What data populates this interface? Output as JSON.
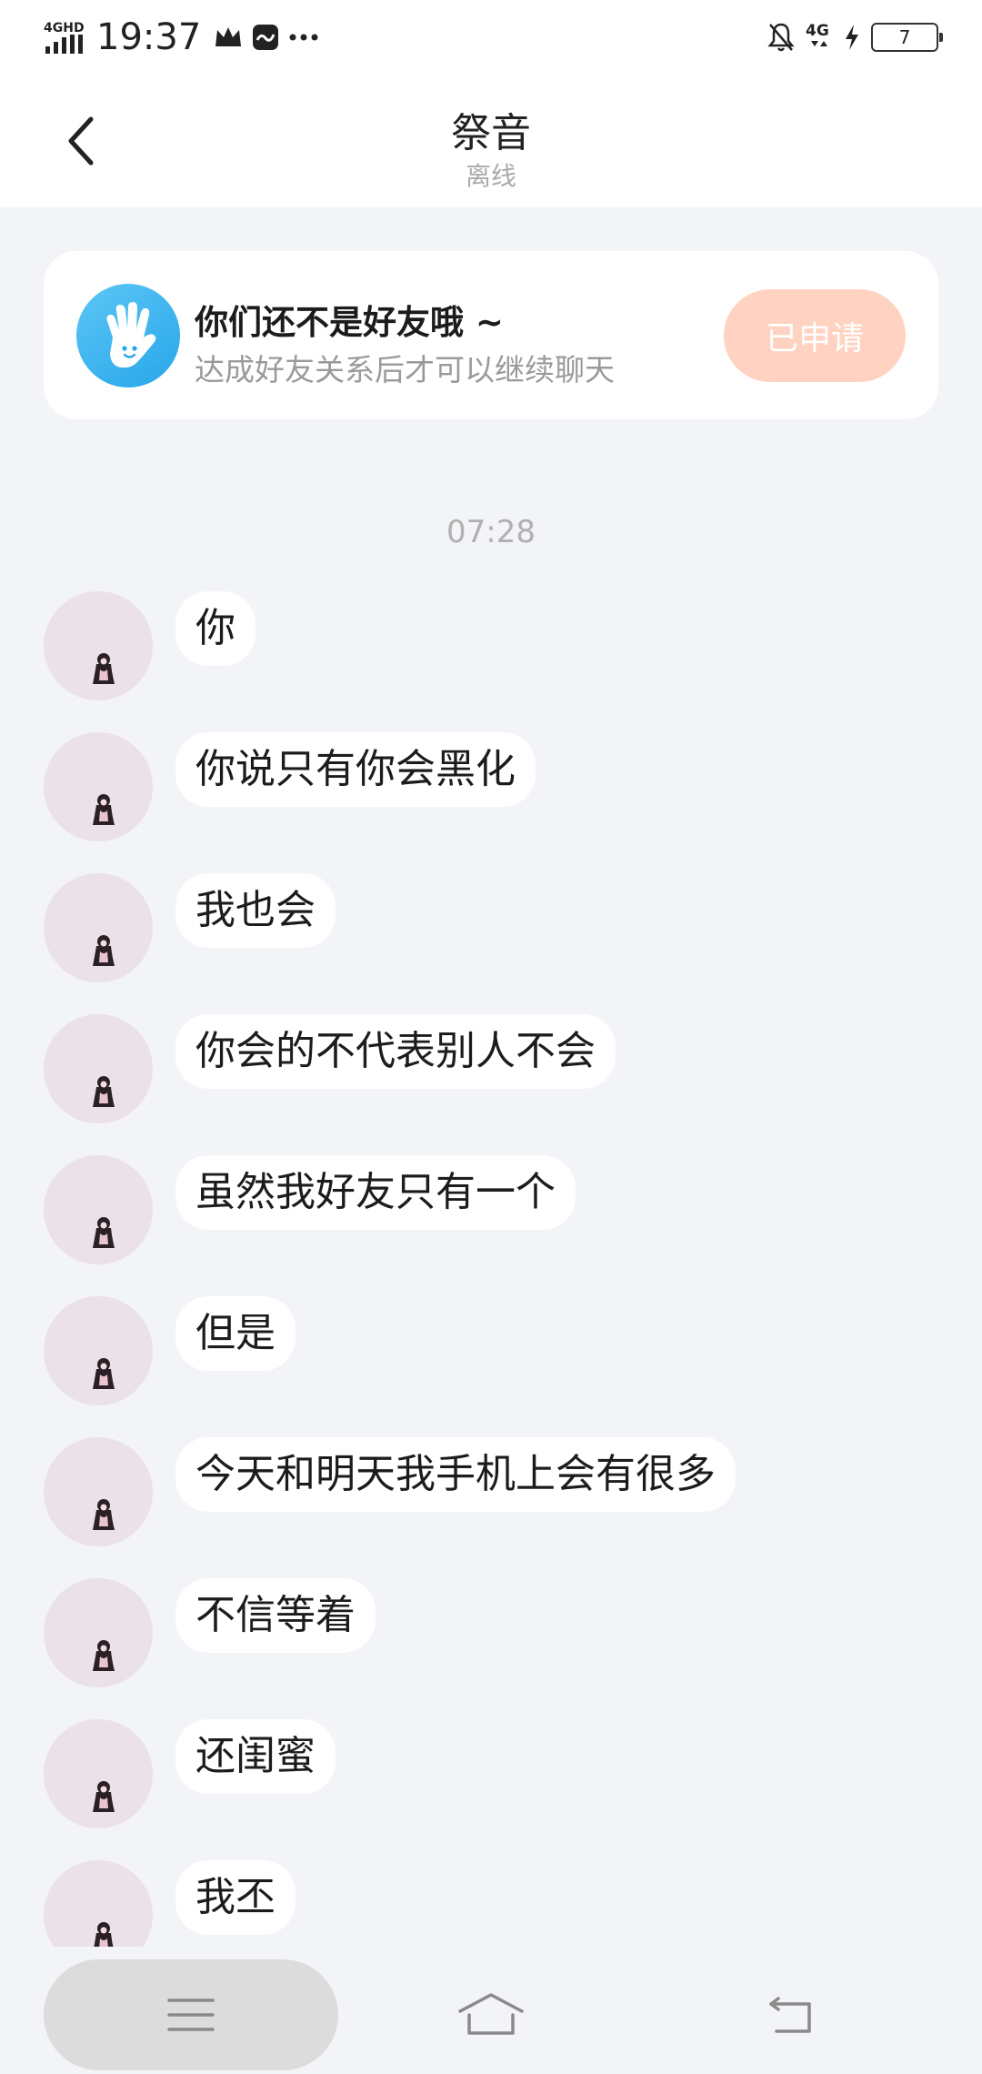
{
  "status_bar": {
    "network": "4GHD",
    "time": "19:37",
    "icons": [
      "signal-icon",
      "crown-icon",
      "app-icon",
      "more-dots-icon",
      "mute-bell-icon",
      "4g-icon",
      "charging-icon"
    ],
    "network_right": "4G",
    "battery": "7"
  },
  "header": {
    "title": "祭音",
    "subtitle": "离线"
  },
  "friend_card": {
    "title": "你们还不是好友哦 ~",
    "subtitle": "达成好友关系后才可以继续聊天",
    "button_label": "已申请",
    "button_color": "#ffd2c1",
    "icon": "wave-hand-icon"
  },
  "chat": {
    "timestamp": "07:28",
    "messages": [
      {
        "text": "你"
      },
      {
        "text": "你说只有你会黑化"
      },
      {
        "text": "我也会"
      },
      {
        "text": "你会的不代表别人不会"
      },
      {
        "text": "虽然我好友只有一个"
      },
      {
        "text": "但是"
      },
      {
        "text": "今天和明天我手机上会有很多"
      },
      {
        "text": "不信等着"
      },
      {
        "text": "还闺蜜"
      },
      {
        "text": "我丕"
      }
    ]
  },
  "bottom_nav": {
    "icons": [
      "menu-icon",
      "home-icon",
      "back-icon"
    ]
  }
}
